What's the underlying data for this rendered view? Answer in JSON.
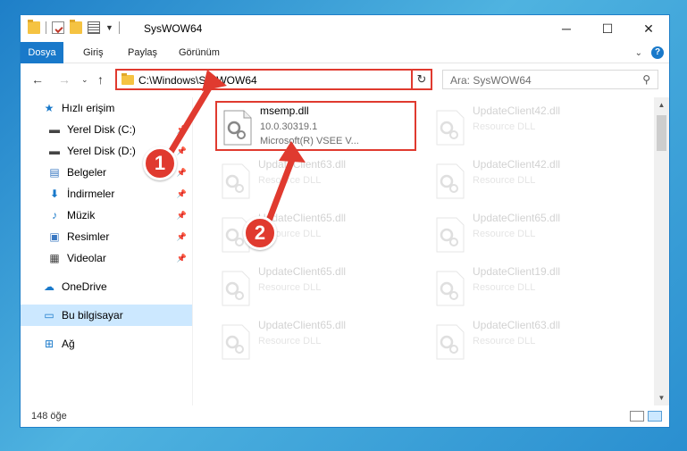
{
  "window": {
    "title": "SysWOW64",
    "controls": {
      "minimize": "─",
      "maximize": "☐",
      "close": "✕"
    }
  },
  "ribbon": {
    "tabs": [
      "Dosya",
      "Giriş",
      "Paylaş",
      "Görünüm"
    ]
  },
  "address_bar": {
    "path": "C:\\Windows\\SysWOW64",
    "search_placeholder": "Ara: SysWOW64"
  },
  "nav_pane": {
    "items": [
      {
        "label": "Hızlı erişim",
        "icon": "star-icon"
      },
      {
        "label": "Yerel Disk (C:)",
        "icon": "drive-icon"
      },
      {
        "label": "Yerel Disk (D:)",
        "icon": "drive-icon"
      },
      {
        "label": "Belgeler",
        "icon": "documents-icon"
      },
      {
        "label": "İndirmeler",
        "icon": "download-icon"
      },
      {
        "label": "Müzik",
        "icon": "music-icon"
      },
      {
        "label": "Resimler",
        "icon": "pictures-icon"
      },
      {
        "label": "Videolar",
        "icon": "videos-icon"
      },
      {
        "label": "OneDrive",
        "icon": "cloud-icon"
      },
      {
        "label": "Bu bilgisayar",
        "icon": "computer-icon",
        "selected": true
      },
      {
        "label": "Ağ",
        "icon": "network-icon"
      }
    ]
  },
  "files": [
    {
      "name": "msemp.dll",
      "version": "10.0.30319.1",
      "description": "Microsoft(R) VSEE V...",
      "highlighted": true
    },
    {
      "name": "UpdateClient42.dll",
      "description": "Resource DLL"
    },
    {
      "name": "UpdateClient63.dll",
      "description": "Resource DLL"
    },
    {
      "name": "UpdateClient42.dll",
      "description": "Resource DLL"
    },
    {
      "name": "UpdateClient65.dll",
      "description": "Resource DLL"
    },
    {
      "name": "UpdateClient65.dll",
      "description": "Resource DLL"
    },
    {
      "name": "UpdateClient65.dll",
      "description": "Resource DLL"
    },
    {
      "name": "UpdateClient19.dll",
      "description": "Resource DLL"
    },
    {
      "name": "UpdateClient65.dll",
      "description": "Resource DLL"
    },
    {
      "name": "UpdateClient63.dll",
      "description": "Resource DLL"
    }
  ],
  "status": {
    "item_count": "148 öğe"
  },
  "callouts": {
    "one": "1",
    "two": "2"
  },
  "colors": {
    "accent": "#1979ca",
    "highlight": "#e03a2f",
    "selected_bg": "#cce8ff"
  }
}
